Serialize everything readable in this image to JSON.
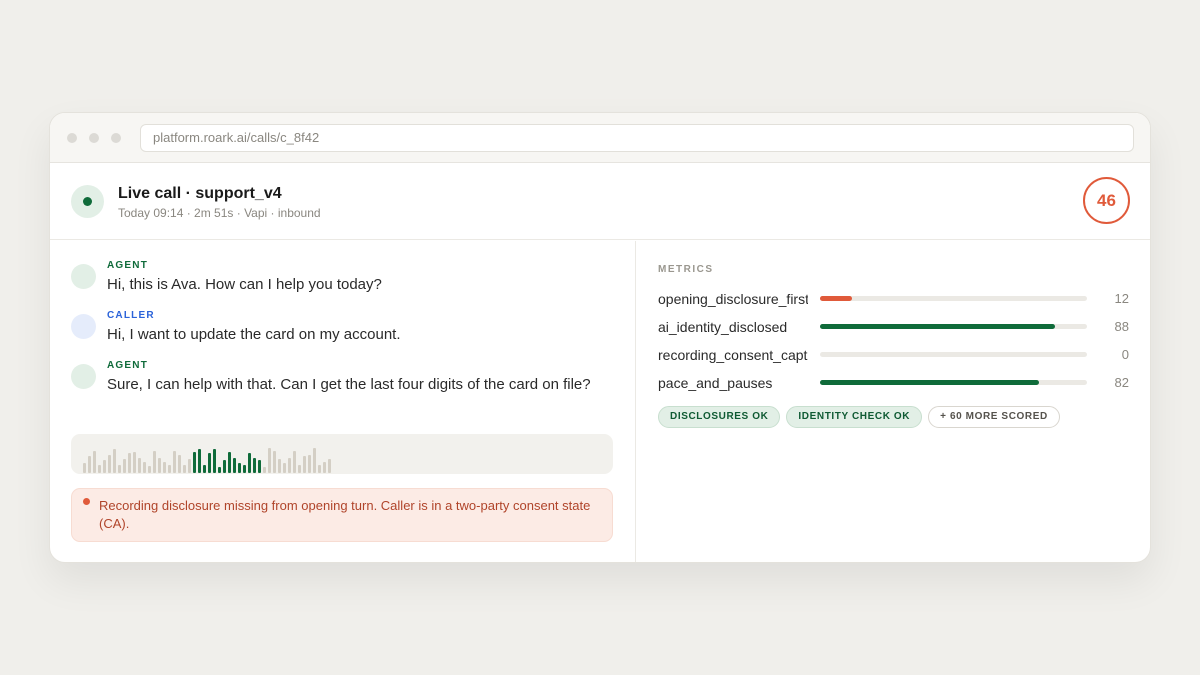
{
  "browser": {
    "url": "platform.roark.ai/calls/c_8f42"
  },
  "call": {
    "title": "Live call · support_v4",
    "meta": "Today 09:14 · 2m 51s · Vapi · inbound",
    "score": "46",
    "score_color": "#e05a3a",
    "status_color": "#0f6b3a"
  },
  "transcript": [
    {
      "role": "AGENT",
      "kind": "agent",
      "text": "Hi, this is Ava. How can I help you today?"
    },
    {
      "role": "CALLER",
      "kind": "caller",
      "text": "Hi, I want to update the card on my account."
    },
    {
      "role": "AGENT",
      "kind": "agent",
      "text": "Sure, I can help with that. Can I get the last four digits of the card on file?"
    }
  ],
  "waveform": {
    "levels": [
      0.35,
      0.6,
      0.8,
      0.3,
      0.45,
      0.65,
      0.85,
      0.3,
      0.5,
      0.7,
      0.75,
      0.55,
      0.4,
      0.25,
      0.8,
      0.55,
      0.4,
      0.3,
      0.8,
      0.65,
      0.3,
      0.5,
      0.75,
      0.85,
      0.3,
      0.7,
      0.85,
      0.2,
      0.45,
      0.75,
      0.55,
      0.35,
      0.3,
      0.7,
      0.55,
      0.45,
      0.2,
      0.9,
      0.8,
      0.5,
      0.35,
      0.55,
      0.8,
      0.3,
      0.6,
      0.65,
      0.9,
      0.3,
      0.4,
      0.5
    ],
    "active_range": [
      22,
      36
    ],
    "color": "#0f6b3a"
  },
  "alert": {
    "text": "Recording disclosure missing from opening turn. Caller is in a two-party consent state (CA).",
    "color": "#e05a3a"
  },
  "metrics": {
    "label": "METRICS",
    "items": [
      {
        "name": "opening_disclosure_first",
        "value": 12,
        "color": "#e05a3a"
      },
      {
        "name": "ai_identity_disclosed",
        "value": 88,
        "color": "#0f6b3a"
      },
      {
        "name": "recording_consent_captured",
        "value": 0,
        "color": "#0f6b3a"
      },
      {
        "name": "pace_and_pauses",
        "value": 82,
        "color": "#0f6b3a"
      }
    ],
    "badges": [
      {
        "label": "DISCLOSURES OK",
        "kind": "ok"
      },
      {
        "label": "IDENTITY CHECK OK",
        "kind": "ok"
      },
      {
        "label": "+ 60 MORE SCORED",
        "kind": "more"
      }
    ]
  }
}
